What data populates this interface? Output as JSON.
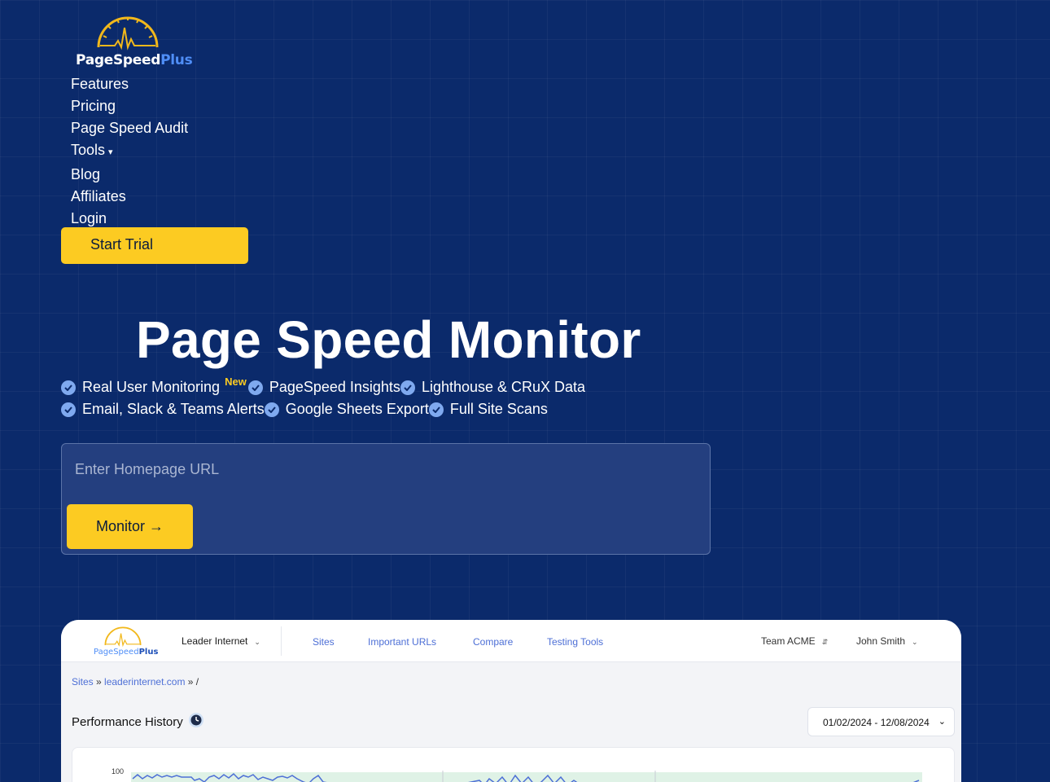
{
  "brand": {
    "name_part1": "PageSpeed",
    "name_part2": "Plus"
  },
  "nav": {
    "items": [
      "Features",
      "Pricing",
      "Page Speed Audit",
      "Tools",
      "Blog",
      "Affiliates",
      "Login"
    ],
    "tools_caret": "▾",
    "cta_label": "Start Trial"
  },
  "hero": {
    "title": "Page Speed Monitor",
    "features_row1": [
      "Real User Monitoring",
      "PageSpeed Insights",
      "Lighthouse & CRuX Data"
    ],
    "new_badge": "New",
    "features_row2": [
      "Email, Slack & Teams Alerts",
      "Google Sheets Export",
      "Full Site Scans"
    ]
  },
  "form": {
    "placeholder": "Enter Homepage URL",
    "button_label": "Monitor →"
  },
  "app": {
    "brand_part1": "PageSpeed",
    "brand_part2": "Plus",
    "site_selector": "Leader Internet",
    "tabs": [
      "Sites",
      "Important URLs",
      "Compare",
      "Testing Tools"
    ],
    "team": "Team ACME",
    "user": "John Smith",
    "breadcrumb": {
      "root": "Sites",
      "domain": "leaderinternet.com",
      "path": "/"
    },
    "perf_title": "Performance History",
    "date_range": "01/02/2024 - 12/08/2024",
    "chart_y_top": "100"
  },
  "colors": {
    "background": "#0b2a6b",
    "accent_yellow": "#fccb22",
    "check_blue": "#7fa9ef",
    "link_blue": "#4d6fd6"
  }
}
